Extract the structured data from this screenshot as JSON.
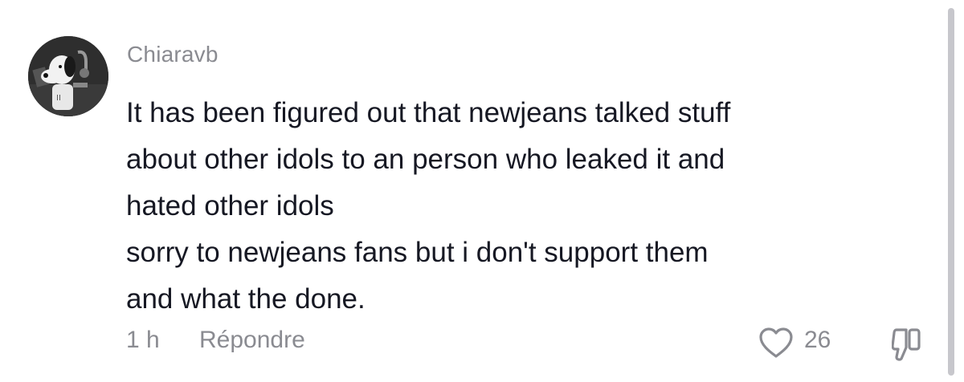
{
  "comment": {
    "username": "Chiaravb",
    "text_lines": [
      "It has been figured out that newjeans talked stuff",
      "about other idols to an person who leaked it and",
      "hated other idols",
      "sorry to newjeans fans but i don't support them",
      "and what the done."
    ],
    "time": "1 h",
    "reply_label": "Répondre",
    "like_count": "26"
  },
  "icons": {
    "avatar": "snoopy-avatar",
    "like": "heart-outline-icon",
    "dislike": "thumbs-down-icon"
  },
  "colors": {
    "text": "#161823",
    "secondary": "#8a8b91",
    "scrollbar": "#c7c7cc"
  }
}
